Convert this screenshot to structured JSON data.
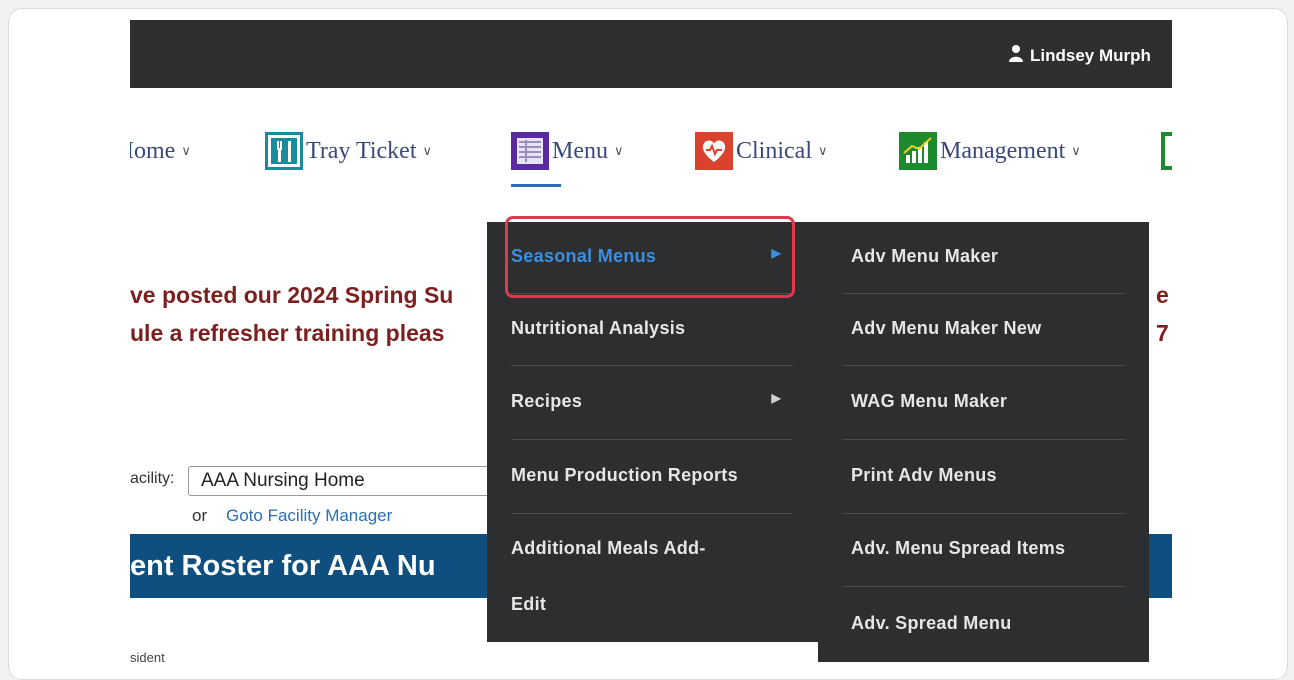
{
  "header": {
    "user_name": "Lindsey Murph"
  },
  "nav": [
    {
      "label": "Iome",
      "icon": "home-icon"
    },
    {
      "label": "Tray Ticket",
      "icon": "fork-knife-icon"
    },
    {
      "label": "Menu",
      "icon": "menu-grid-icon"
    },
    {
      "label": "Clinical",
      "icon": "heart-icon"
    },
    {
      "label": "Management",
      "icon": "bar-chart-icon"
    }
  ],
  "notice": {
    "line1": "ve posted our 2024 Spring Su",
    "line2": "ule a refresher training pleas",
    "right1": "e",
    "right2": "7"
  },
  "facility": {
    "label": "acility:",
    "value": "AAA Nursing Home",
    "or_text": "or",
    "goto_link": "Goto Facility Manager"
  },
  "roster_title": "ent Roster for AAA Nu",
  "resident_cut": "sident",
  "menu_dropdown": [
    {
      "label": "Seasonal Menus",
      "has_submenu": true,
      "active": true
    },
    {
      "label": "Nutritional Analysis",
      "has_submenu": false
    },
    {
      "label": "Recipes",
      "has_submenu": true
    },
    {
      "label": "Menu Production Reports",
      "has_submenu": false
    },
    {
      "label": "Additional Meals Add-",
      "has_submenu": false
    },
    {
      "label": "Edit",
      "has_submenu": false
    }
  ],
  "seasonal_submenu": [
    "Adv Menu Maker",
    "Adv Menu Maker New",
    "WAG Menu Maker",
    "Print Adv Menus",
    "Adv. Menu Spread Items",
    "Adv. Spread Menu"
  ],
  "colors": {
    "topbar": "#2f2f2f",
    "dropdown_bg": "#2c2e30",
    "active_item": "#3c8fe0",
    "highlight_border": "#e0394c",
    "roster_bg": "#0f4f7f",
    "notice_text": "#7b1f1f"
  }
}
